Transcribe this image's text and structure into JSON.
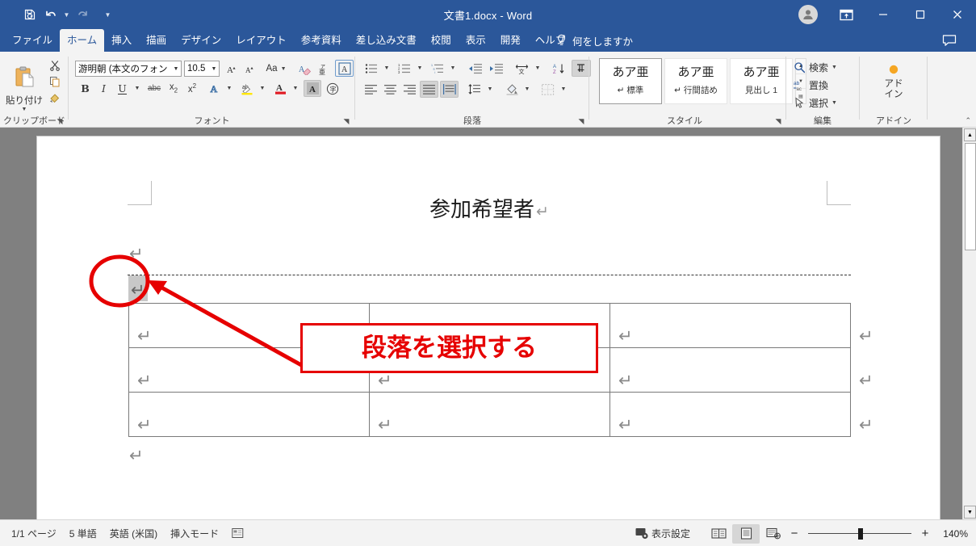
{
  "window": {
    "title": "文書1.docx  -  Word",
    "accent": "#2b579a",
    "quick_access": [
      {
        "name": "save",
        "icon": "save-icon"
      },
      {
        "name": "undo",
        "icon": "undo-icon"
      },
      {
        "name": "redo",
        "icon": "redo-icon"
      },
      {
        "name": "customize",
        "icon": "customize-qat-icon"
      }
    ],
    "controls": {
      "ribbon_display": "ribbon-display-options-icon",
      "minimize": "–",
      "maximize": "▢",
      "close": "✕"
    }
  },
  "ribbon": {
    "tabs": [
      {
        "label": "ファイル",
        "active": false
      },
      {
        "label": "ホーム",
        "active": true
      },
      {
        "label": "挿入",
        "active": false
      },
      {
        "label": "描画",
        "active": false
      },
      {
        "label": "デザイン",
        "active": false
      },
      {
        "label": "レイアウト",
        "active": false
      },
      {
        "label": "参考資料",
        "active": false
      },
      {
        "label": "差し込み文書",
        "active": false
      },
      {
        "label": "校閲",
        "active": false
      },
      {
        "label": "表示",
        "active": false
      },
      {
        "label": "開発",
        "active": false
      },
      {
        "label": "ヘルプ",
        "active": false
      }
    ],
    "tell_me": "何をしますか",
    "groups": {
      "clipboard": {
        "label": "クリップボード",
        "paste_label": "貼り付け",
        "buttons": [
          "cut-icon",
          "copy-icon",
          "format-painter-icon"
        ]
      },
      "font": {
        "label": "フォント",
        "font_name": "游明朝 (本文のフォン",
        "font_size": "10.5",
        "buttons": [
          "grow-font-icon",
          "shrink-font-icon",
          "change-case-icon",
          "clear-formatting-icon",
          "phonetic-guide-icon",
          "character-border-icon",
          "bold-icon",
          "italic-icon",
          "underline-icon",
          "strikethrough-icon",
          "subscript-icon",
          "superscript-icon",
          "text-effects-icon",
          "text-highlight-icon",
          "font-color-icon",
          "character-shading-icon",
          "enclose-character-icon"
        ]
      },
      "paragraph": {
        "label": "段落",
        "buttons": [
          "bullets-icon",
          "numbering-icon",
          "multilevel-list-icon",
          "decrease-indent-icon",
          "increase-indent-icon",
          "asian-layout-icon",
          "sort-icon",
          "show-formatting-marks-icon",
          "align-left-icon",
          "align-center-icon",
          "align-right-icon",
          "justify-icon",
          "distribute-icon",
          "line-spacing-icon",
          "shading-icon",
          "borders-icon"
        ]
      },
      "styles": {
        "label": "スタイル",
        "items": [
          {
            "sample": "あア亜",
            "name": "↵ 標準",
            "selected": true
          },
          {
            "sample": "あア亜",
            "name": "↵ 行間詰め",
            "selected": false
          },
          {
            "sample": "あア亜",
            "name": "見出し 1",
            "selected": false
          }
        ]
      },
      "editing": {
        "label": "編集",
        "items": [
          {
            "label": "検索",
            "icon": "search-icon",
            "caret": true
          },
          {
            "label": "置換",
            "icon": "replace-icon",
            "caret": false
          },
          {
            "label": "選択",
            "icon": "select-icon",
            "caret": true
          }
        ]
      },
      "addins": {
        "label": "アドイン",
        "button_label": "アド\nイン",
        "button_line1": "アド",
        "button_line2": "イン"
      }
    }
  },
  "document": {
    "title_text": "参加希望者",
    "pilcrow": "↵",
    "table": {
      "rows": 3,
      "cols": 3,
      "cell_mark": "↵",
      "row_end_mark": "↵"
    },
    "annotation": {
      "callout_text": "段落を選択する",
      "callout_color": "#e60000",
      "ellipse_color": "#e60000",
      "arrow_color": "#e60000"
    }
  },
  "statusbar": {
    "page": "1/1 ページ",
    "words": "5 単語",
    "language": "英語 (米国)",
    "mode": "挿入モード",
    "accessibility_icon": "accessibility-check-icon",
    "display_settings": "表示設定",
    "views": [
      {
        "name": "read-mode",
        "active": false
      },
      {
        "name": "print-layout",
        "active": true
      },
      {
        "name": "web-layout",
        "active": false
      }
    ],
    "zoom_out": "−",
    "zoom_in": "+",
    "zoom_level": "140%"
  }
}
